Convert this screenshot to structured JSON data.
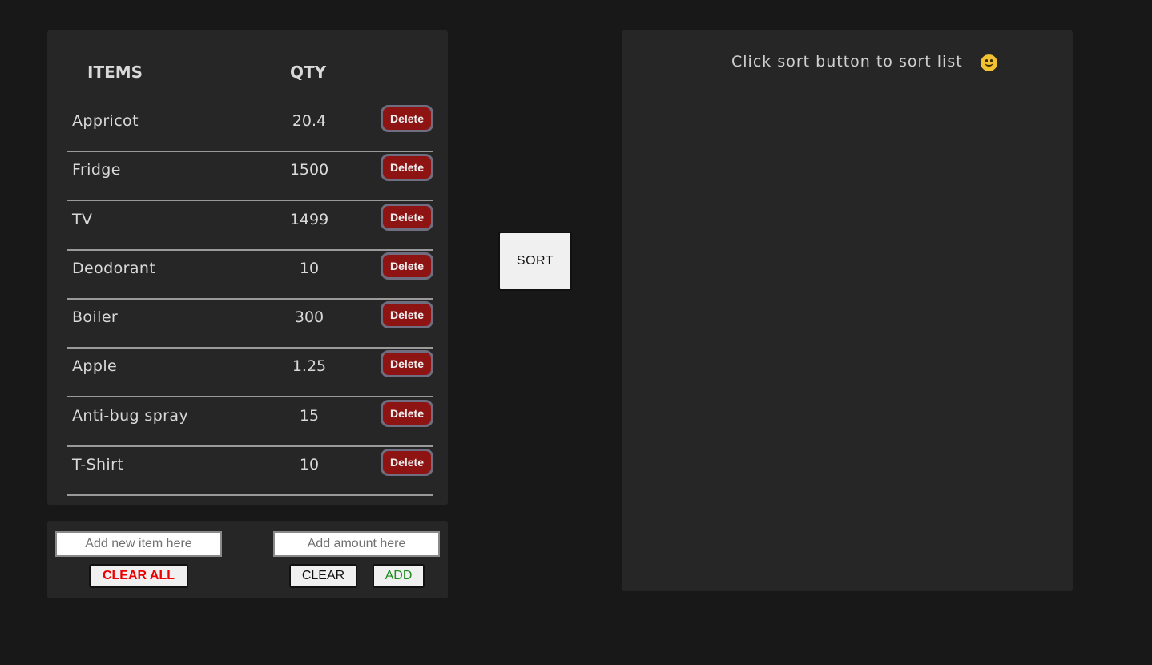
{
  "list": {
    "headers": {
      "items": "ITEMS",
      "qty": "QTY"
    },
    "delete_label": "Delete",
    "rows": [
      {
        "name": "Appricot",
        "qty": "20.4"
      },
      {
        "name": "Fridge",
        "qty": "1500"
      },
      {
        "name": "TV",
        "qty": "1499"
      },
      {
        "name": "Deodorant",
        "qty": "10"
      },
      {
        "name": "Boiler",
        "qty": "300"
      },
      {
        "name": "Apple",
        "qty": "1.25"
      },
      {
        "name": "Anti-bug spray",
        "qty": "15"
      },
      {
        "name": "T-Shirt",
        "qty": "10"
      }
    ]
  },
  "inputs": {
    "item_placeholder": "Add new item here",
    "amount_placeholder": "Add amount here",
    "clear_all_label": "CLEAR ALL",
    "clear_label": "CLEAR",
    "add_label": "ADD"
  },
  "sort": {
    "button_label": "SORT",
    "hint": "Click sort button to sort list"
  },
  "colors": {
    "background": "#181818",
    "panel": "#262626",
    "delete_button": "#8e1414",
    "clear_all_text": "#ee0000",
    "add_text": "#1a8a1a"
  },
  "icons": {
    "hint_icon": "smiley-face-icon"
  }
}
